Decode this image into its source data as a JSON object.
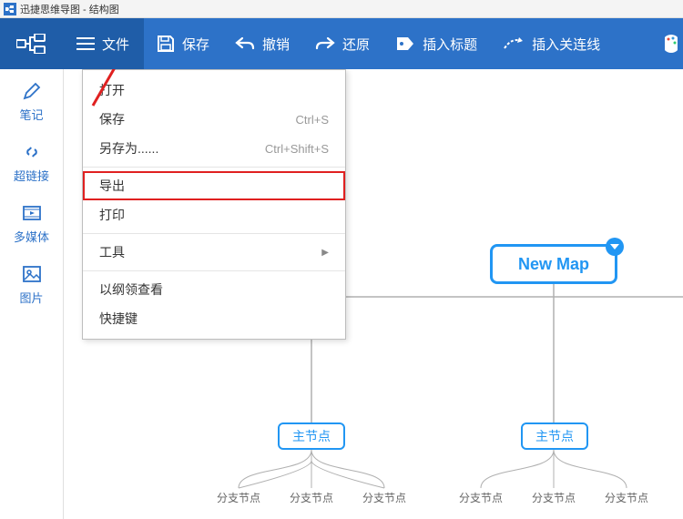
{
  "window": {
    "title": "迅捷思维导图 - 结构图"
  },
  "toolbar": {
    "file": "文件",
    "save": "保存",
    "undo": "撤销",
    "redo": "还原",
    "insert_title": "插入标题",
    "insert_relation": "插入关连线"
  },
  "sidebar": {
    "notes": "笔记",
    "hyperlink": "超链接",
    "multimedia": "多媒体",
    "image": "图片"
  },
  "menu": {
    "open": "打开",
    "save": {
      "label": "保存",
      "shortcut": "Ctrl+S"
    },
    "save_as": {
      "label": "另存为......",
      "shortcut": "Ctrl+Shift+S"
    },
    "export": "导出",
    "print": "打印",
    "tools": "工具",
    "outline_view": "以纲领查看",
    "shortcuts": "快捷键"
  },
  "mindmap": {
    "root": "New Map",
    "main_node": "主节点",
    "leaf": "分支节点"
  }
}
